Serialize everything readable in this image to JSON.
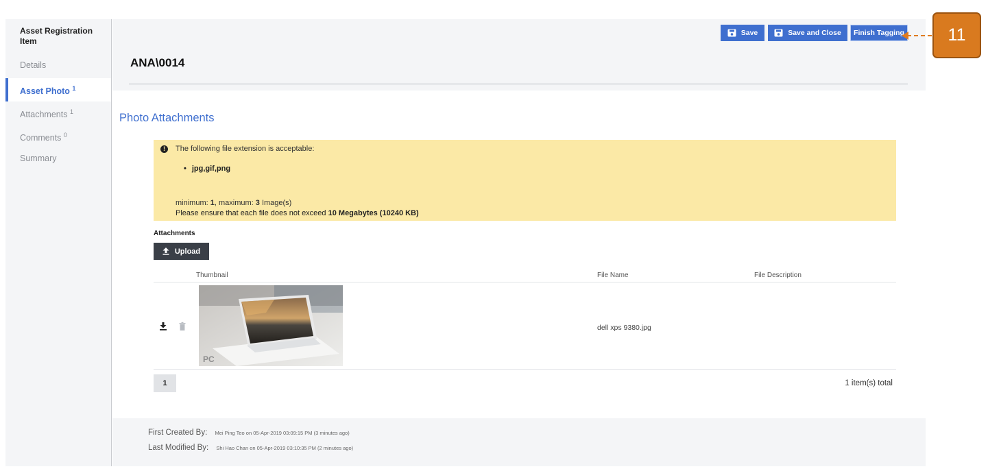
{
  "sidebar": {
    "title": "Asset Registration Item",
    "items": [
      {
        "label": "Details",
        "count": ""
      },
      {
        "label": "Asset Photo",
        "count": "1"
      },
      {
        "label": "Attachments",
        "count": "1"
      },
      {
        "label": "Comments",
        "count": "0"
      },
      {
        "label": "Summary",
        "count": ""
      }
    ]
  },
  "toolbar": {
    "save_label": "Save",
    "save_close_label": "Save and Close",
    "finish_label": "Finish Tagging"
  },
  "header": {
    "title": "ANA\\0014"
  },
  "section": {
    "title": "Photo Attachments"
  },
  "notice": {
    "line1": "The following file extension is acceptable:",
    "extensions": "jpg,gif,png",
    "min_label": "minimum: ",
    "min_value": "1",
    "max_label": ", maximum: ",
    "max_value": "3",
    "unit": " Image(s)",
    "size_prefix": "Please ensure that each file does not exceed ",
    "size_value": "10 Megabytes (10240 KB)"
  },
  "attachments": {
    "label": "Attachments",
    "upload_label": "Upload",
    "columns": [
      "Thumbnail",
      "File Name",
      "File Description"
    ],
    "rows": [
      {
        "file_name": "dell xps 9380.jpg",
        "file_description": "",
        "thumbnail_watermark": "PC"
      }
    ]
  },
  "pagination": {
    "current_page": "1",
    "total_text": "1 item(s) total"
  },
  "audit": {
    "created_label": "First Created By:",
    "created_value": "Mei Ping Teo on 05-Apr-2019 03:09:15 PM (3 minutes ago)",
    "modified_label": "Last Modified By:",
    "modified_value": "Shi Hao Chan on 05-Apr-2019 03:10:35 PM (2 minutes ago)"
  },
  "callout": {
    "number": "11"
  },
  "colors": {
    "accent": "#3f6fcf",
    "notice_bg": "#fbe9a6",
    "callout": "#d97a1f",
    "dark_button": "#3a3f47"
  },
  "icons": [
    "floppy-disk-icon",
    "upload-icon",
    "download-icon",
    "trash-icon",
    "exclamation-icon"
  ]
}
